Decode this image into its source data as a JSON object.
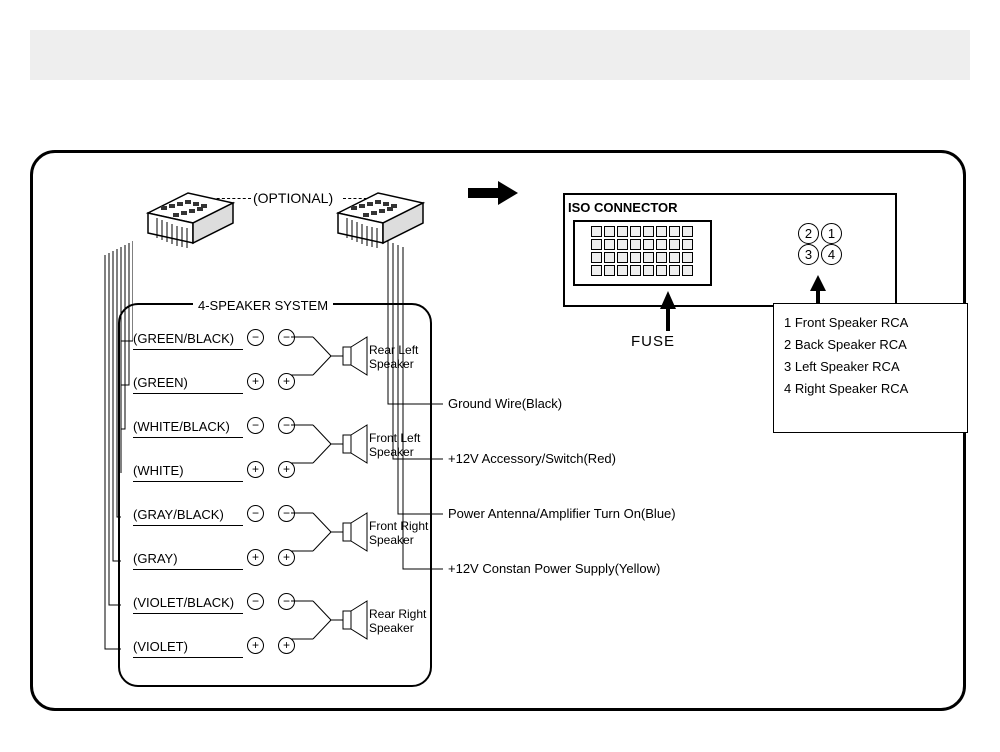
{
  "labels": {
    "optional": "(OPTIONAL)",
    "iso_title": "ISO CONNECTOR",
    "fuse": "FUSE",
    "speaker_system": "4-SPEAKER SYSTEM"
  },
  "speaker_wires": [
    {
      "color": "(GREEN/BLACK)",
      "polarity": "−"
    },
    {
      "color": "(GREEN)",
      "polarity": "+"
    },
    {
      "color": "(WHITE/BLACK)",
      "polarity": "−"
    },
    {
      "color": "(WHITE)",
      "polarity": "+"
    },
    {
      "color": "(GRAY/BLACK)",
      "polarity": "−"
    },
    {
      "color": "(GRAY)",
      "polarity": "+"
    },
    {
      "color": "(VIOLET/BLACK)",
      "polarity": "−"
    },
    {
      "color": "(VIOLET)",
      "polarity": "+"
    }
  ],
  "speakers": [
    {
      "name": "Rear Left\nSpeaker"
    },
    {
      "name": "Front Left\nSpeaker"
    },
    {
      "name": "Front Right\nSpeaker"
    },
    {
      "name": "Rear Right\nSpeaker"
    }
  ],
  "power_wires": [
    "Ground Wire(Black)",
    "+12V Accessory/Switch(Red)",
    "Power Antenna/Amplifier Turn On(Blue)",
    "+12V Constan Power Supply(Yellow)"
  ],
  "rca_legend": [
    "1 Front Speaker RCA",
    "2 Back Speaker RCA",
    "3 Left  Speaker RCA",
    "4 Right  Speaker RCA"
  ],
  "rca_numbers": [
    [
      "2",
      "1"
    ],
    [
      "3",
      "4"
    ]
  ]
}
